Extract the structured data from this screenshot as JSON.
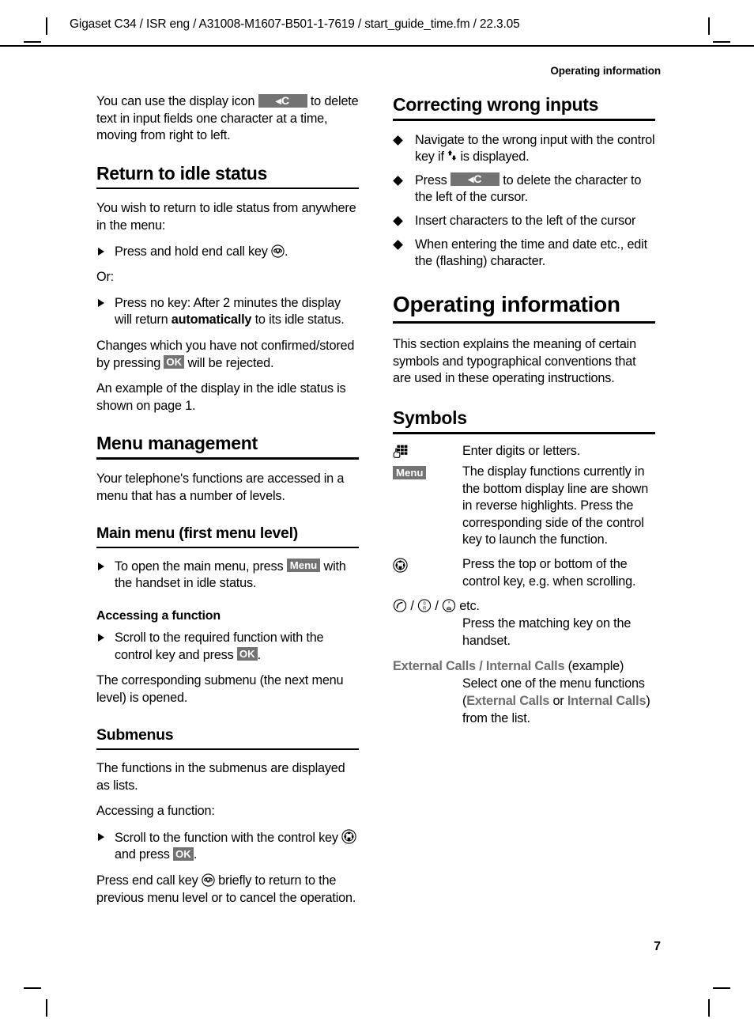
{
  "header": {
    "file_line": "Gigaset C34 / ISR eng / A31008-M1607-B501-1-7619 / start_guide_time.fm / 22.3.05",
    "running_head": "Operating information"
  },
  "footer": {
    "page_number": "7"
  },
  "colors": {
    "key_badge_bg": "#737373",
    "key_badge_fg": "#ffffff",
    "gray_bold_text": "#6e6e6e",
    "rule": "#000000",
    "page_bg": "#ffffff"
  },
  "left_column": {
    "intro": {
      "before_icon": "You can use the display icon ",
      "icon_label": "◂C",
      "after_icon": " to delete text in input fields one character at a time, moving from right to left."
    },
    "return_to_idle": {
      "heading": "Return to idle status",
      "lead": "You wish to return to idle status from anywhere in the menu:",
      "step1_before": "Press and hold end call key ",
      "step1_icon": "end-call-key",
      "step1_after": ".",
      "or_label": "Or:",
      "step2_a": "Press no key: After 2 minutes the display will return ",
      "step2_bold": "automatically",
      "step2_b": " to its idle status.",
      "para1_a": "Changes which you have not confirmed/stored by pressing ",
      "para1_badge": "OK",
      "para1_b": " will be rejected.",
      "para2": "An example of the display in the idle status is shown on page 1."
    },
    "menu_management": {
      "heading": "Menu management",
      "lead": "Your telephone's functions are accessed in a menu that has a number of levels.",
      "main_menu": {
        "heading": "Main menu (first menu level)",
        "step_a": "To open the main menu, press ",
        "step_badge": "Menu",
        "step_b": " with the handset in idle status."
      },
      "accessing_function": {
        "heading": "Accessing a function",
        "step_a": "Scroll to the required function with the control key and press ",
        "step_badge": "OK",
        "step_b": ".",
        "para": "The corresponding submenu (the next menu level) is opened."
      },
      "submenus": {
        "heading": "Submenus",
        "para1": "The functions in the submenus are displayed as lists.",
        "para2": "Accessing a function:",
        "step_a": "Scroll to the function with the control key ",
        "step_icon": "control-key",
        "step_b": " and press ",
        "step_badge": "OK",
        "step_c": ".",
        "para3_a": "Press end call key ",
        "para3_icon": "end-call-key",
        "para3_b": " briefly to return to the previous menu level or to cancel the operation."
      }
    }
  },
  "right_column": {
    "correcting": {
      "heading": "Correcting wrong inputs",
      "bullets": [
        {
          "a": "Navigate to the wrong input with the control key if ",
          "icon": "up-down-arrow",
          "b": " is displayed."
        },
        {
          "a": "Press ",
          "badge": "◂C",
          "b": " to delete the character to the left of the cursor."
        },
        {
          "a": "Insert characters to the left of the cursor"
        },
        {
          "a": "When entering the time and date etc., edit the (flashing) character."
        }
      ]
    },
    "operating_information": {
      "heading": "Operating information",
      "para": "This section explains the meaning of certain symbols and typographical conventions that are used in these operating instructions."
    },
    "symbols": {
      "heading": "Symbols",
      "rows": [
        {
          "key_icon": "keypad-icon",
          "definition": "Enter digits or letters."
        },
        {
          "key_badge": "Menu",
          "definition": "The display functions currently in the bottom display line are shown in reverse highlights. Press the corresponding side of the control key to launch the function."
        },
        {
          "key_icon": "control-key",
          "definition": "Press the top or bottom of the control key, e.g. when scrolling."
        }
      ],
      "keys_row": {
        "icons": [
          "talk-key",
          "zero-r-key",
          "star-bell-key"
        ],
        "separator": "/",
        "suffix": "etc.",
        "definition": "Press the matching key on the handset."
      },
      "menu_example_row": {
        "label_1": "External Calls",
        "separator": " / ",
        "label_2": "Internal Calls",
        "label_suffix": " (example)",
        "definition_a": "Select one of the menu functions (",
        "definition_b": "External Calls",
        "definition_c": " or ",
        "definition_d": "Internal Calls",
        "definition_e": ") from the list."
      }
    }
  }
}
